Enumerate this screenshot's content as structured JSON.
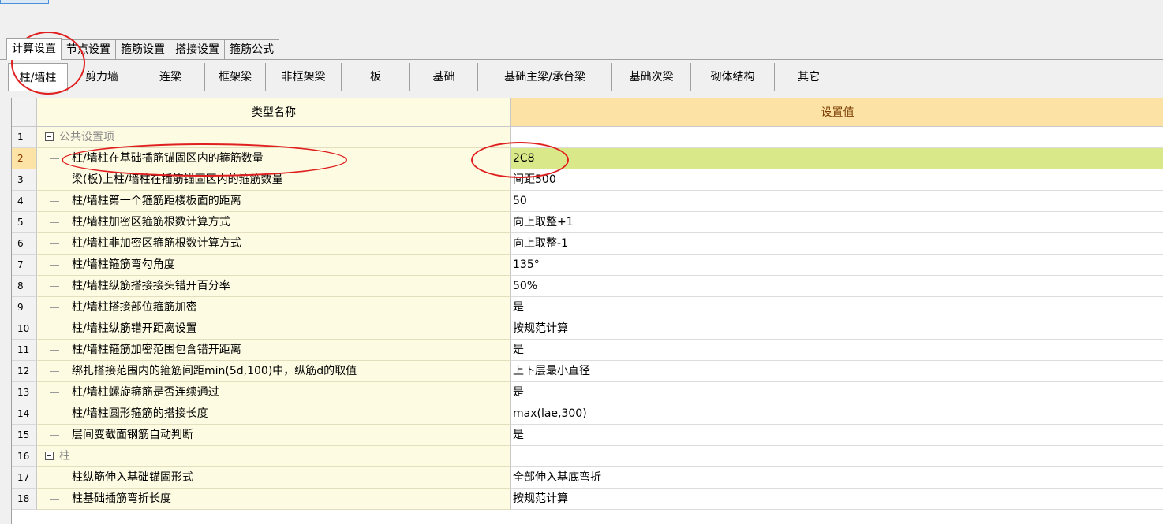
{
  "tabs": [
    {
      "label": "计算设置",
      "active": true
    },
    {
      "label": "节点设置"
    },
    {
      "label": "箍筋设置"
    },
    {
      "label": "搭接设置"
    },
    {
      "label": "箍筋公式"
    }
  ],
  "subtabs": [
    {
      "label": "柱/墙柱",
      "active": true
    },
    {
      "label": "剪力墙"
    },
    {
      "label": "连梁"
    },
    {
      "label": "框架梁"
    },
    {
      "label": "非框架梁"
    },
    {
      "label": "板"
    },
    {
      "label": "基础"
    },
    {
      "label": "基础主梁/承台梁"
    },
    {
      "label": "基础次梁"
    },
    {
      "label": "砌体结构"
    },
    {
      "label": "其它"
    }
  ],
  "grid": {
    "col_name": "类型名称",
    "col_value": "设置值",
    "rows": [
      {
        "n": "1",
        "name": "公共设置项",
        "value": "",
        "group": true
      },
      {
        "n": "2",
        "name": "柱/墙柱在基础插筋锚固区内的箍筋数量",
        "value": "2C8",
        "selected": true
      },
      {
        "n": "3",
        "name": "梁(板)上柱/墙柱在插筋锚固区内的箍筋数量",
        "value": "间距500"
      },
      {
        "n": "4",
        "name": "柱/墙柱第一个箍筋距楼板面的距离",
        "value": "50"
      },
      {
        "n": "5",
        "name": "柱/墙柱加密区箍筋根数计算方式",
        "value": "向上取整+1"
      },
      {
        "n": "6",
        "name": "柱/墙柱非加密区箍筋根数计算方式",
        "value": "向上取整-1"
      },
      {
        "n": "7",
        "name": "柱/墙柱箍筋弯勾角度",
        "value": "135°"
      },
      {
        "n": "8",
        "name": "柱/墙柱纵筋搭接接头错开百分率",
        "value": "50%"
      },
      {
        "n": "9",
        "name": "柱/墙柱搭接部位箍筋加密",
        "value": "是"
      },
      {
        "n": "10",
        "name": "柱/墙柱纵筋错开距离设置",
        "value": "按规范计算"
      },
      {
        "n": "11",
        "name": "柱/墙柱箍筋加密范围包含错开距离",
        "value": "是"
      },
      {
        "n": "12",
        "name": "绑扎搭接范围内的箍筋间距min(5d,100)中，纵筋d的取值",
        "value": "上下层最小直径"
      },
      {
        "n": "13",
        "name": "柱/墙柱螺旋箍筋是否连续通过",
        "value": "是"
      },
      {
        "n": "14",
        "name": "柱/墙柱圆形箍筋的搭接长度",
        "value": "max(lae,300)"
      },
      {
        "n": "15",
        "name": "层间变截面钢筋自动判断",
        "value": "是"
      },
      {
        "n": "16",
        "name": "柱",
        "value": "",
        "group": true
      },
      {
        "n": "17",
        "name": "柱纵筋伸入基础锚固形式",
        "value": "全部伸入基底弯折"
      },
      {
        "n": "18",
        "name": "柱基础插筋弯折长度",
        "value": "按规范计算"
      }
    ]
  }
}
